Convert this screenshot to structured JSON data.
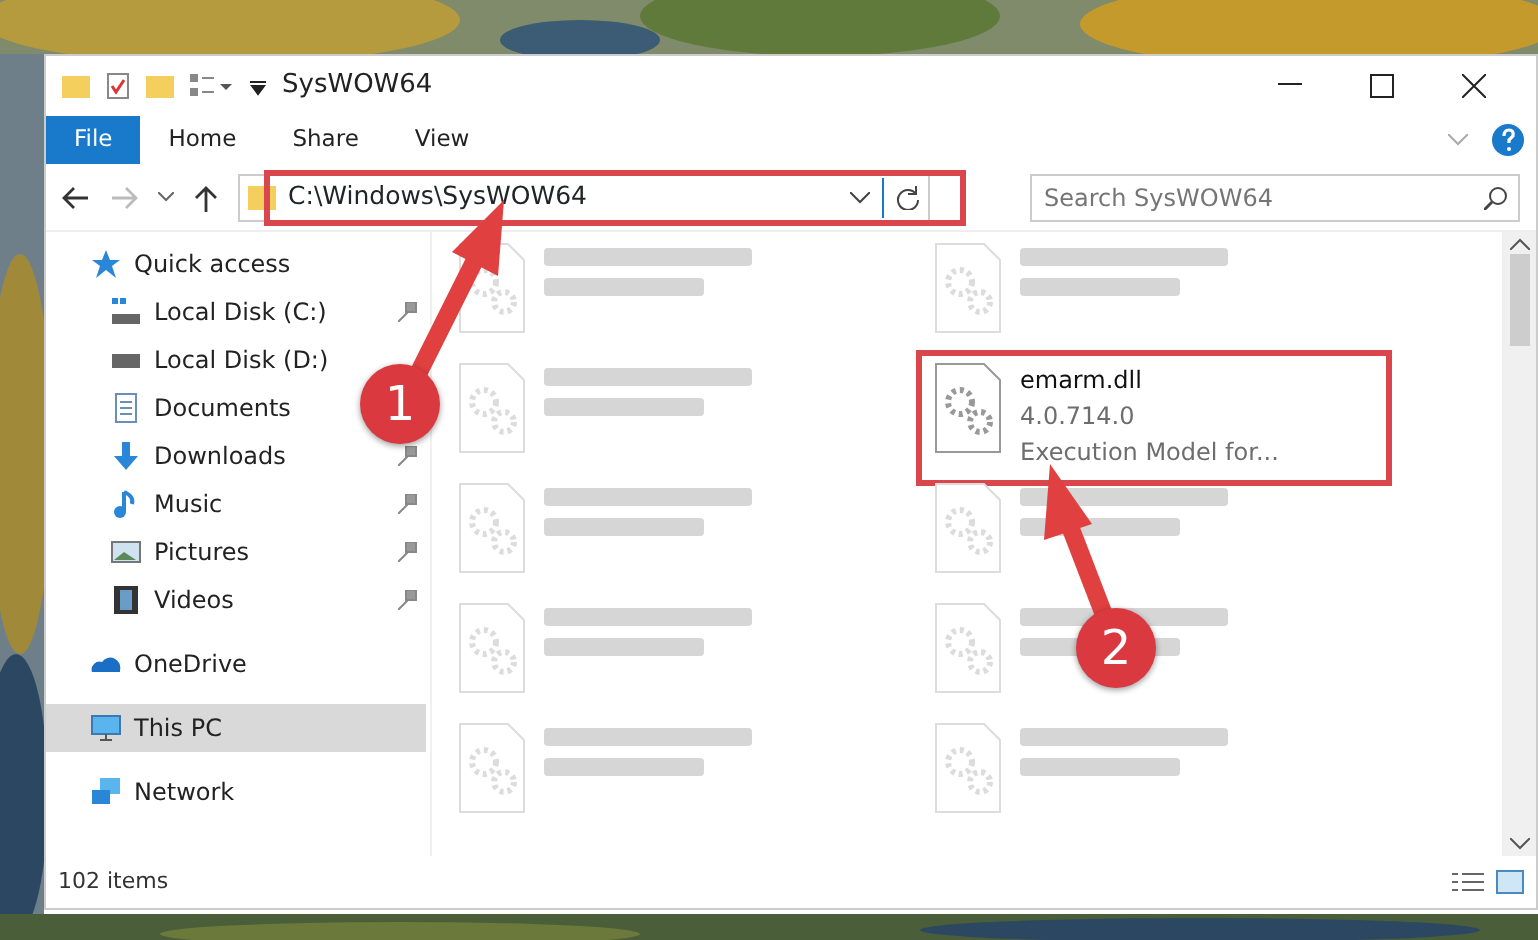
{
  "window": {
    "title": "SysWOW64"
  },
  "ribbon_tabs": [
    {
      "label": "File",
      "selected": true
    },
    {
      "label": "Home",
      "selected": false
    },
    {
      "label": "Share",
      "selected": false
    },
    {
      "label": "View",
      "selected": false
    }
  ],
  "address_bar": {
    "path": "C:\\Windows\\SysWOW64"
  },
  "search": {
    "placeholder": "Search SysWOW64"
  },
  "sidebar": {
    "items": [
      {
        "label": "Quick access",
        "kind": "star",
        "selected": false,
        "children": [
          {
            "label": "Local Disk (C:)",
            "kind": "drive-c",
            "pinned": true,
            "selected": false
          },
          {
            "label": "Local Disk (D:)",
            "kind": "drive",
            "pinned": false,
            "selected": false
          },
          {
            "label": "Documents",
            "kind": "documents",
            "pinned": false,
            "selected": false
          },
          {
            "label": "Downloads",
            "kind": "downloads",
            "pinned": true,
            "selected": false
          },
          {
            "label": "Music",
            "kind": "music",
            "pinned": true,
            "selected": false
          },
          {
            "label": "Pictures",
            "kind": "pictures",
            "pinned": true,
            "selected": false
          },
          {
            "label": "Videos",
            "kind": "videos",
            "pinned": true,
            "selected": false
          }
        ]
      },
      {
        "label": "OneDrive",
        "kind": "cloud",
        "selected": false
      },
      {
        "label": "This PC",
        "kind": "pc",
        "selected": true
      },
      {
        "label": "Network",
        "kind": "network",
        "selected": false
      }
    ]
  },
  "files": [
    {
      "kind": "blurred"
    },
    {
      "kind": "blurred"
    },
    {
      "kind": "blurred"
    },
    {
      "kind": "file",
      "name": "emarm.dll",
      "lines": [
        "4.0.714.0",
        "Execution Model for..."
      ],
      "highlighted": true
    },
    {
      "kind": "blurred"
    },
    {
      "kind": "blurred"
    },
    {
      "kind": "blurred"
    },
    {
      "kind": "blurred"
    },
    {
      "kind": "blurred"
    },
    {
      "kind": "blurred"
    }
  ],
  "status_bar": {
    "count": "102 items"
  },
  "callouts": [
    {
      "number": "1"
    },
    {
      "number": "2"
    }
  ]
}
